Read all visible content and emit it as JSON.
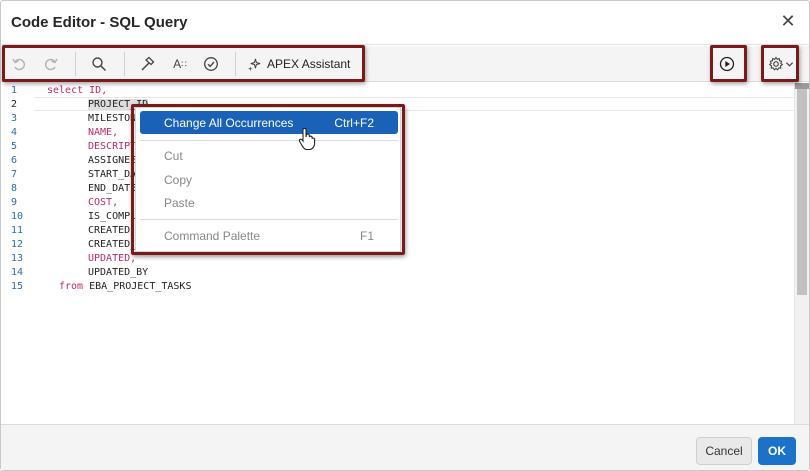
{
  "dialog": {
    "title": "Code Editor - SQL Query",
    "close_icon": "close-icon"
  },
  "toolbar": {
    "undo_icon": "undo-icon",
    "redo_icon": "redo-icon",
    "search_icon": "search-icon",
    "hammer_icon": "hammer-icon",
    "autocomplete_icon": "text-case-icon",
    "validate_icon": "check-circle-icon",
    "apex_assistant_icon": "sparkle-icon",
    "apex_assistant_label": "APEX Assistant",
    "run_icon": "play-circle-icon",
    "settings_icon": "gear-icon",
    "settings_dropdown_icon": "chevron-down-icon"
  },
  "editor": {
    "lines": [
      {
        "num": "1",
        "pre": "select ",
        "kw": "select",
        "text": "ID,"
      },
      {
        "num": "2",
        "text": "PROJECT_ID"
      },
      {
        "num": "3",
        "text": "MILESTON"
      },
      {
        "num": "4",
        "text": "NAME,"
      },
      {
        "num": "5",
        "text": "DESCRIPT"
      },
      {
        "num": "6",
        "text": "ASSIGNEE"
      },
      {
        "num": "7",
        "text": "START_DA"
      },
      {
        "num": "8",
        "text": "END_DATE"
      },
      {
        "num": "9",
        "text": "COST,"
      },
      {
        "num": "10",
        "text": "IS_COMPL"
      },
      {
        "num": "11",
        "text": "CREATED,"
      },
      {
        "num": "12",
        "text": "CREATED_"
      },
      {
        "num": "13",
        "text": "UPDATED,"
      },
      {
        "num": "14",
        "text": "UPDATED_BY"
      },
      {
        "num": "15",
        "kw": "from",
        "text": "EBA_PROJECT_TASKS"
      }
    ]
  },
  "context_menu": {
    "items": [
      {
        "label": "Change All Occurrences",
        "shortcut": "Ctrl+F2"
      },
      {
        "label": "Cut",
        "shortcut": ""
      },
      {
        "label": "Copy",
        "shortcut": ""
      },
      {
        "label": "Paste",
        "shortcut": ""
      },
      {
        "label": "Command Palette",
        "shortcut": "F1"
      }
    ]
  },
  "footer": {
    "cancel_label": "Cancel",
    "ok_label": "OK"
  },
  "colors": {
    "keyword": "#c02a67",
    "line_number": "#2b6ea3",
    "menu_active": "#1a62b7",
    "ok_button": "#1a73c9",
    "highlight_box": "#7a1a1a"
  }
}
